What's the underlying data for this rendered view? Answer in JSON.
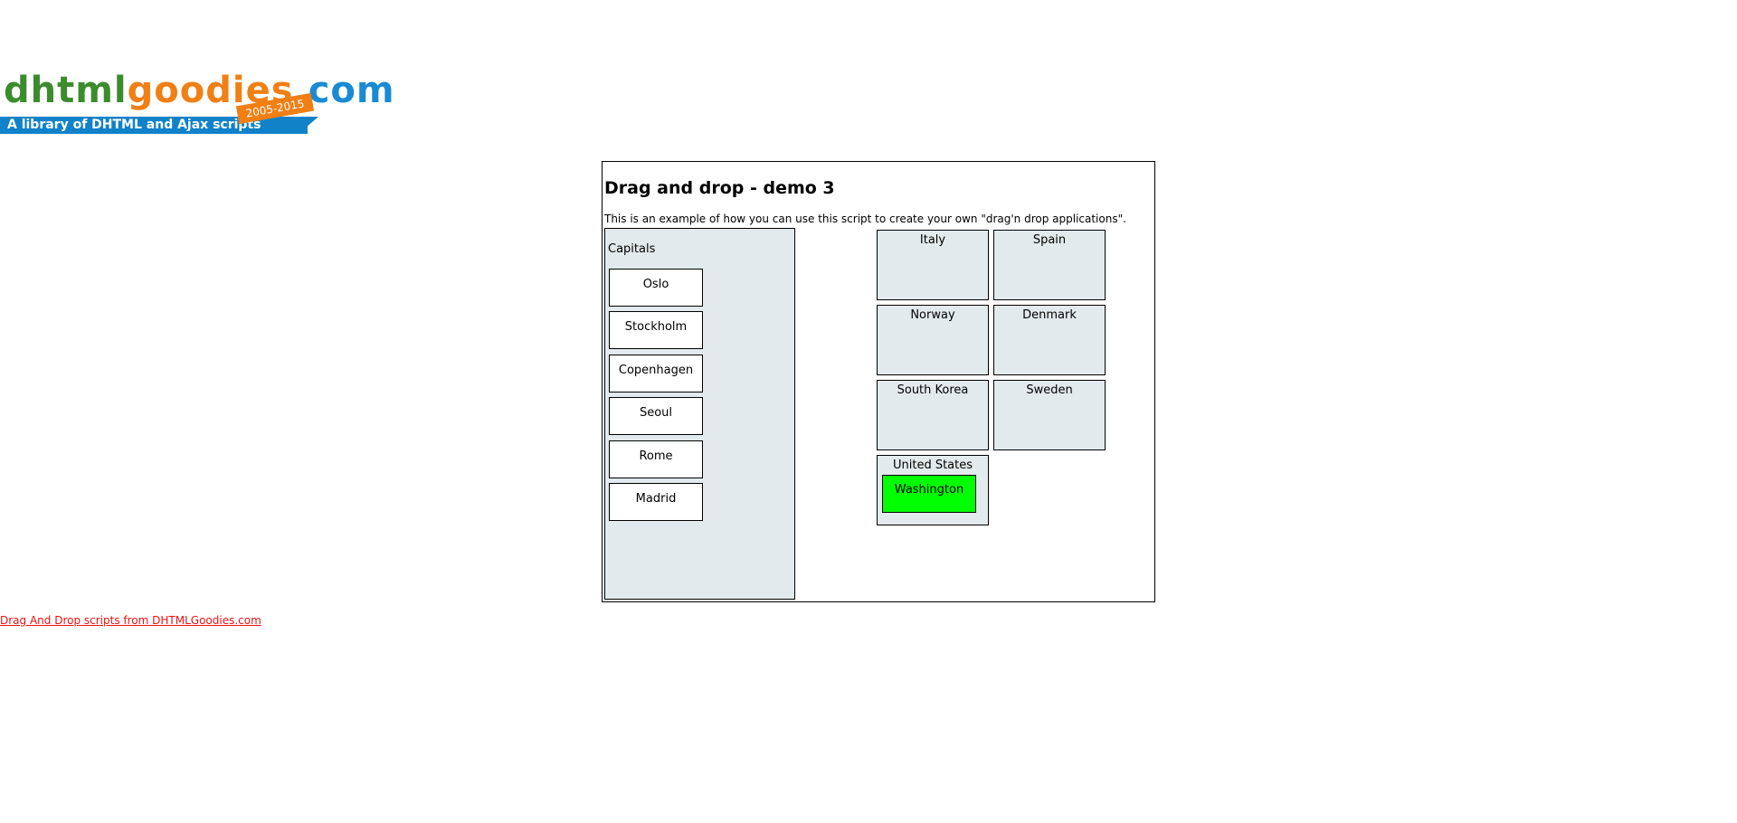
{
  "logo": {
    "part1": "dhtml",
    "part2": "goodies",
    "part3": ".com",
    "years": "2005-2015",
    "tagline": "A library of DHTML and Ajax scripts"
  },
  "demo": {
    "title": "Drag and drop - demo 3",
    "description": "This is an example of how you can use this script to create your own \"drag'n drop applications\"."
  },
  "capitals": {
    "title": "Capitals",
    "items": [
      "Oslo",
      "Stockholm",
      "Copenhagen",
      "Seoul",
      "Rome",
      "Madrid"
    ]
  },
  "countries": [
    {
      "name": "Italy",
      "capital": ""
    },
    {
      "name": "Spain",
      "capital": ""
    },
    {
      "name": "Norway",
      "capital": ""
    },
    {
      "name": "Denmark",
      "capital": ""
    },
    {
      "name": "South Korea",
      "capital": ""
    },
    {
      "name": "Sweden",
      "capital": ""
    },
    {
      "name": "United States",
      "capital": "Washington"
    }
  ],
  "colors": {
    "box_background": "#e2eaed",
    "correct_drop": "#00ff00",
    "footer_link": "#ee1111",
    "logo_green": "#3c8c2e",
    "logo_orange": "#f07f14",
    "logo_blue": "#1a8ad4"
  },
  "footer": {
    "link_text": "Drag And Drop scripts from DHTMLGoodies.com"
  }
}
